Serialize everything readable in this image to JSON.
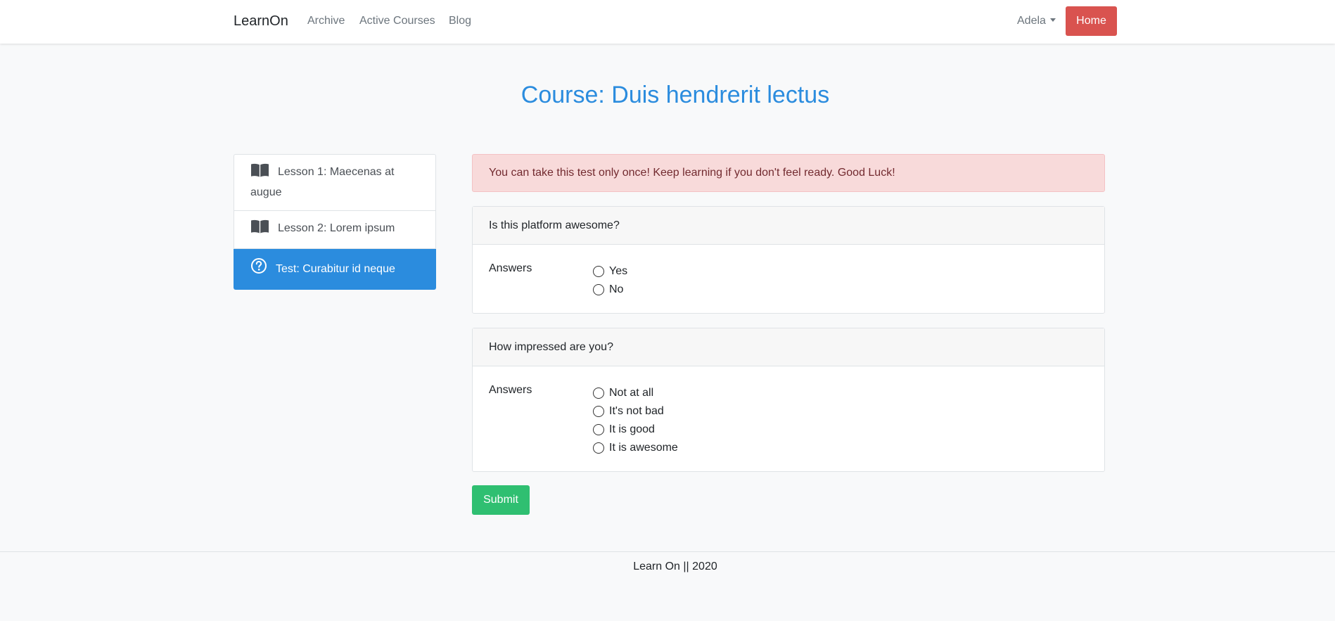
{
  "navbar": {
    "brand": "LearnOn",
    "links": [
      "Archive",
      "Active Courses",
      "Blog"
    ],
    "user": "Adela",
    "home_button": "Home"
  },
  "page": {
    "title": "Course: Duis hendrerit lectus"
  },
  "sidebar": {
    "items": [
      {
        "label": "Lesson 1: Maecenas at augue",
        "icon": "book-icon",
        "active": false
      },
      {
        "label": "Lesson 2: Lorem ipsum",
        "icon": "book-icon",
        "active": false
      },
      {
        "label": "Test: Curabitur id neque",
        "icon": "question-circle-icon",
        "active": true
      }
    ]
  },
  "alert": {
    "text": "You can take this test only once! Keep learning if you don't feel ready. Good Luck!"
  },
  "questions": [
    {
      "title": "Is this platform awesome?",
      "answers_label": "Answers",
      "options": [
        "Yes",
        "No"
      ]
    },
    {
      "title": "How impressed are you?",
      "answers_label": "Answers",
      "options": [
        "Not at all",
        "It's not bad",
        "It is good",
        "It is awesome"
      ]
    }
  ],
  "submit_label": "Submit",
  "footer": {
    "text": "Learn On || 2020"
  },
  "colors": {
    "primary": "#2b8cde",
    "danger": "#d9534f",
    "success": "#2fbf71",
    "alert_bg": "#f8dada"
  }
}
